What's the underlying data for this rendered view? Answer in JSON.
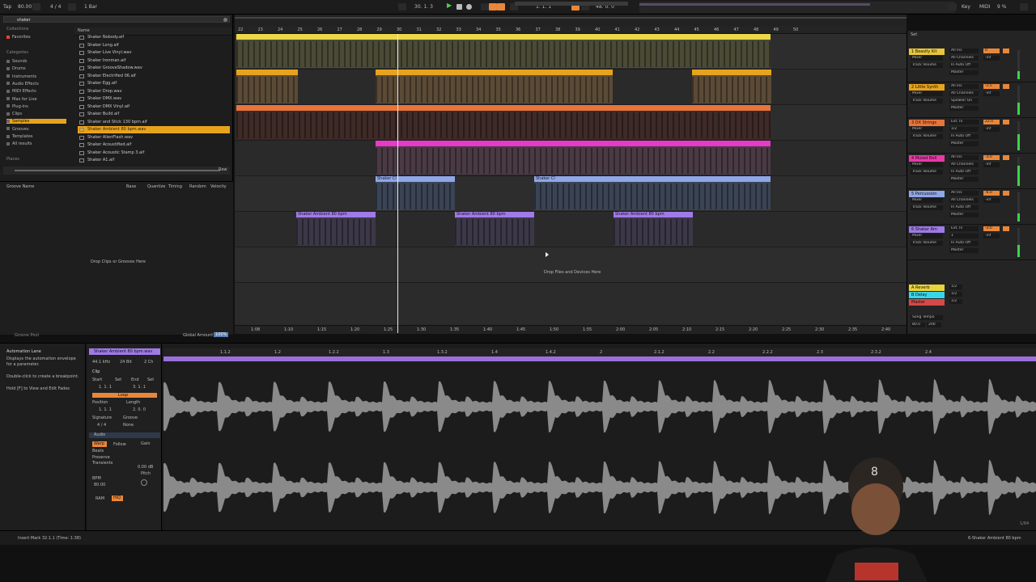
{
  "topbar": {
    "tap": "Tap",
    "tempo": "80.00",
    "sig": "4 / 4",
    "quant": "1 Bar",
    "pos": "30.   1.   3",
    "pos2": "1.   1.   1",
    "loop_len": "48.   0.   0",
    "key": "Key",
    "midi": "MIDI",
    "cpu": "9 %"
  },
  "browser": {
    "search_value": "shaker",
    "collections_label": "Collections",
    "favorites": "Favorites",
    "categories_label": "Categories",
    "categories": [
      "Sounds",
      "Drums",
      "Instruments",
      "Audio Effects",
      "MIDI Effects",
      "Max for Live",
      "Plug-ins",
      "Clips",
      "Samples",
      "Grooves",
      "Templates",
      "All results"
    ],
    "places_label": "Places",
    "name_header": "Name",
    "files": [
      "Shaker Nobody.aif",
      "Shaker Long.aif",
      "Shaker Live Vinyl.wav",
      "Shaker Ironman.aif",
      "Shaker GrooveShadow.wav",
      "Shaker Electrified 06.aif",
      "Shaker Egg.aif",
      "Shaker Drop.wav",
      "Shaker DMX.wav",
      "Shaker DMX Vinyl.aif",
      "Shaker Build.aif",
      "Shaker and Stick 130 bpm.aif",
      "Shaker Ambient 80 bpm.wav",
      "Shaker AlienFlash.wav",
      "Shaker Acoustified.aif",
      "Shaker Acoustic Stamp 3.aif",
      "Shaker A1.aif"
    ],
    "selected_index": 12,
    "raw_label": "Raw"
  },
  "groove": {
    "headers": [
      "Groove Name",
      "Base",
      "Quantize",
      "Timing",
      "Random",
      "Velocity"
    ],
    "drop_text": "Drop Clips or Grooves Here",
    "pool_label": "Groove Pool",
    "global_amount_label": "Global Amount",
    "global_amount": "100%"
  },
  "arrange": {
    "bar_numbers": [
      "22",
      "23",
      "24",
      "25",
      "26",
      "27",
      "28",
      "29",
      "30",
      "31",
      "32",
      "33",
      "34",
      "35",
      "36",
      "37",
      "38",
      "39",
      "40",
      "41",
      "42",
      "43",
      "44",
      "45",
      "46",
      "47",
      "48",
      "49",
      "50"
    ],
    "drop_text": "Drop Files and Devices Here",
    "time_labels": [
      "1:08",
      "1:10",
      "1:15",
      "1:20",
      "1:25",
      "1:30",
      "1:35",
      "1:40",
      "1:45",
      "1:50",
      "1:55",
      "2:00",
      "2:05",
      "2:10",
      "2:15",
      "2:20",
      "2:25",
      "2:30",
      "2:35",
      "2:40"
    ],
    "clip_label_shaker": "Shaker Cl",
    "clip_label_ambient": "Shaker Ambient 80 bpm"
  },
  "mixer": {
    "set_label": "Set",
    "tracks": [
      {
        "name": "1 Beastly Kit",
        "color": "#e8c53a",
        "in": "All Ins",
        "ch": "All Channels",
        "monitor": "In Auto Off",
        "out": "Master",
        "vol": "0"
      },
      {
        "name": "2 Little Synth",
        "color": "#e8a31d",
        "in": "All Ins",
        "ch": "All Channels",
        "monitor": "Speaker On",
        "out": "Master",
        "vol": "-1.5"
      },
      {
        "name": "3 DX Strings",
        "color": "#e8743a",
        "in": "Ext. In",
        "ch": "1/2",
        "monitor": "In Auto Off",
        "out": "Master",
        "vol": "22.0"
      },
      {
        "name": "4 Muted Bell",
        "color": "#e83aa6",
        "in": "All Ins",
        "ch": "All Channels",
        "monitor": "In Auto Off",
        "out": "Master",
        "vol": "-3.0"
      },
      {
        "name": "5 Percussion",
        "color": "#8fa6e8",
        "in": "All Ins",
        "ch": "All Channels",
        "monitor": "In Auto Off",
        "out": "Master",
        "vol": "-6.0"
      },
      {
        "name": "6 Shaker Am",
        "color": "#9f7ae8",
        "in": "Ext. In",
        "ch": "1",
        "monitor": "In Auto Off",
        "out": "Master",
        "vol": "-3.0"
      }
    ],
    "returns": [
      {
        "name": "A Reverb",
        "color": "#e8d43a"
      },
      {
        "name": "B Delay",
        "color": "#3ad4e8"
      }
    ],
    "master": {
      "name": "Master",
      "color": "#d44a4a"
    },
    "mixer_label": "Mixer",
    "track_volume": "Track Volume",
    "inf": "-inf",
    "song_tempo": "Song Tempo",
    "tempo_val": "80.0",
    "tempo_max": "200",
    "half": "1/2"
  },
  "info": {
    "title": "Automation Lane",
    "desc": "Displays the automation envelope for a parameter.",
    "hint1": "Double-click to create a breakpoint.",
    "hint2": "Hold [F] to View and Edit Fades"
  },
  "clipview": {
    "clip_name": "Shaker Ambient 80 bpm.wav",
    "rate": "44.1 kHz",
    "bits": "24 Bit",
    "ch": "2 Ch",
    "clip_label": "Clip",
    "start": "Start",
    "set": "Set",
    "end": "End",
    "start_val": "1.  1.  1",
    "end_val": "3.  1.  1",
    "loop": "Loop",
    "position": "Position",
    "length": "Length",
    "pos_val": "1.  1.  1",
    "len_val": "2.  0.  0",
    "signature": "Signature",
    "groove_label": "Groove",
    "sig_val": "4 / 4",
    "groove_val": "None",
    "audio_label": "Audio",
    "warp": "Warp",
    "follow": "Follow",
    "gain": "Gain",
    "beats": "Beats",
    "preserve": "Preserve",
    "transients": "Transients",
    "bpm_label": "BPM",
    "bpm": "80.00",
    "db": "0.00 dB",
    "pitch": "Pitch",
    "ram": "RAM",
    "hiq": "HiQ"
  },
  "status": {
    "left": "Insert Mark 32.1.1 (Time: 1:38)",
    "right": "6-Shaker Ambient 80 bpm"
  },
  "waveform": {
    "markers": [
      "1.1.2",
      "1.2",
      "1.2.2",
      "1.3",
      "1.3.2",
      "1.4",
      "1.4.2",
      "2",
      "2.1.2",
      "2.2",
      "2.2.2",
      "2.3",
      "2.3.2",
      "2.4"
    ],
    "count_right": "1/64"
  }
}
